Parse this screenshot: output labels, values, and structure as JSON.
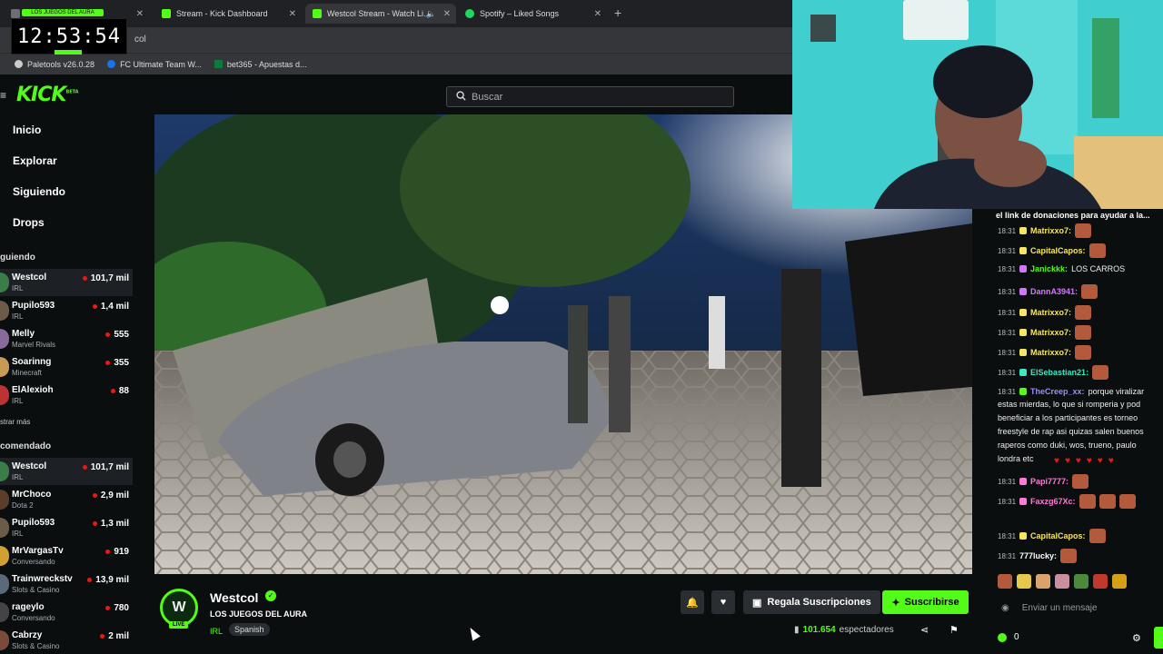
{
  "clock": {
    "time": "12:53:54",
    "flag_text": "LOS JUEGOS DEL AURA"
  },
  "tabs": [
    {
      "title": ""
    },
    {
      "title": "Stream - Kick Dashboard"
    },
    {
      "title": "Westcol Stream - Watch Li…"
    },
    {
      "title": "Spotify – Liked Songs"
    }
  ],
  "urlbar": {
    "value": "col"
  },
  "bookmarks": [
    {
      "label": "Paletools v26.0.28"
    },
    {
      "label": "FC Ultimate Team W..."
    },
    {
      "label": "bet365 - Apuestas d..."
    }
  ],
  "kick": {
    "logo": "KICK",
    "logo_beta": "BETA",
    "search_placeholder": "Buscar",
    "nav": [
      "Inicio",
      "Explorar",
      "Siguiendo",
      "Drops"
    ],
    "following_title": "guiendo",
    "following": [
      {
        "name": "Westcol",
        "category": "IRL",
        "viewers": "101,7 mil"
      },
      {
        "name": "Pupilo593",
        "category": "IRL",
        "viewers": "1,4 mil"
      },
      {
        "name": "Melly",
        "category": "Marvel Rivals",
        "viewers": "555"
      },
      {
        "name": "Soarinng",
        "category": "Minecraft",
        "viewers": "355"
      },
      {
        "name": "ElAlexioh",
        "category": "IRL",
        "viewers": "88"
      }
    ],
    "show_more": "strar más",
    "recommended_title": "comendado",
    "recommended": [
      {
        "name": "Westcol",
        "category": "IRL",
        "viewers": "101,7 mil"
      },
      {
        "name": "MrChoco",
        "category": "Dota 2",
        "viewers": "2,9 mil"
      },
      {
        "name": "Pupilo593",
        "category": "IRL",
        "viewers": "1,3 mil"
      },
      {
        "name": "MrVargasTv",
        "category": "Conversando",
        "viewers": "919"
      },
      {
        "name": "Trainwreckstv",
        "category": "Slots & Casino",
        "viewers": "13,9 mil"
      },
      {
        "name": "rageylo",
        "category": "Conversando",
        "viewers": "780"
      },
      {
        "name": "Cabrzy",
        "category": "Slots & Casino",
        "viewers": "2 mil"
      }
    ],
    "stream": {
      "avatar_text": "W",
      "live_badge": "LIVE",
      "streamer": "Westcol",
      "title": "LOS JUEGOS DEL AURA",
      "category": "IRL",
      "tag": "Spanish",
      "gift_label": "Regala Suscripciones",
      "subscribe_label": "Suscribirse",
      "viewers": "101.654",
      "viewers_label": "espectadores"
    }
  },
  "chat": {
    "pinned": "el link de donaciones para ayudar a la...",
    "messages": [
      {
        "time": "18:31",
        "user": "Matrixxo7:",
        "color": "#f5e663",
        "text": ""
      },
      {
        "time": "18:31",
        "user": "CapitalCapos:",
        "color": "#f5e663",
        "text": ""
      },
      {
        "time": "18:31",
        "user": "Janickkk:",
        "color": "#53fc18",
        "text": "LOS CARROS"
      },
      {
        "time": "18:31",
        "user": "DannA3941:",
        "color": "#d576ff",
        "text": ""
      },
      {
        "time": "18:31",
        "user": "Matrixxo7:",
        "color": "#f5e663",
        "text": ""
      },
      {
        "time": "18:31",
        "user": "Matrixxo7:",
        "color": "#f5e663",
        "text": ""
      },
      {
        "time": "18:31",
        "user": "Matrixxo7:",
        "color": "#f5e663",
        "text": ""
      },
      {
        "time": "18:31",
        "user": "ElSebastian21:",
        "color": "#3ee6c1",
        "text": ""
      },
      {
        "time": "18:31",
        "user": "TheCreep_xx:",
        "color": "#9b8cff",
        "text": "porque viralizar"
      }
    ],
    "wrapped_lines": [
      "estas mierdas, lo que si romperia y pod",
      "beneficiar a los participantes es torneo",
      "freestyle de rap asi quizas salen buenos",
      "raperos como duki, wos, trueno, paulo",
      "londra etc"
    ],
    "messages2": [
      {
        "time": "18:31",
        "user": "Papi7777:",
        "color": "#ff7ad9",
        "text": ""
      },
      {
        "time": "18:31",
        "user": "Faxzg67Xc:",
        "color": "#ff7ad9",
        "text": ""
      },
      {
        "time": "18:31",
        "user": "CapitalCapos:",
        "color": "#f5e663",
        "text": ""
      },
      {
        "time": "18:31",
        "user": "777lucky:",
        "color": "#ffffff",
        "text": ""
      }
    ],
    "input_placeholder": "Enviar un mensaje",
    "points": "0"
  }
}
